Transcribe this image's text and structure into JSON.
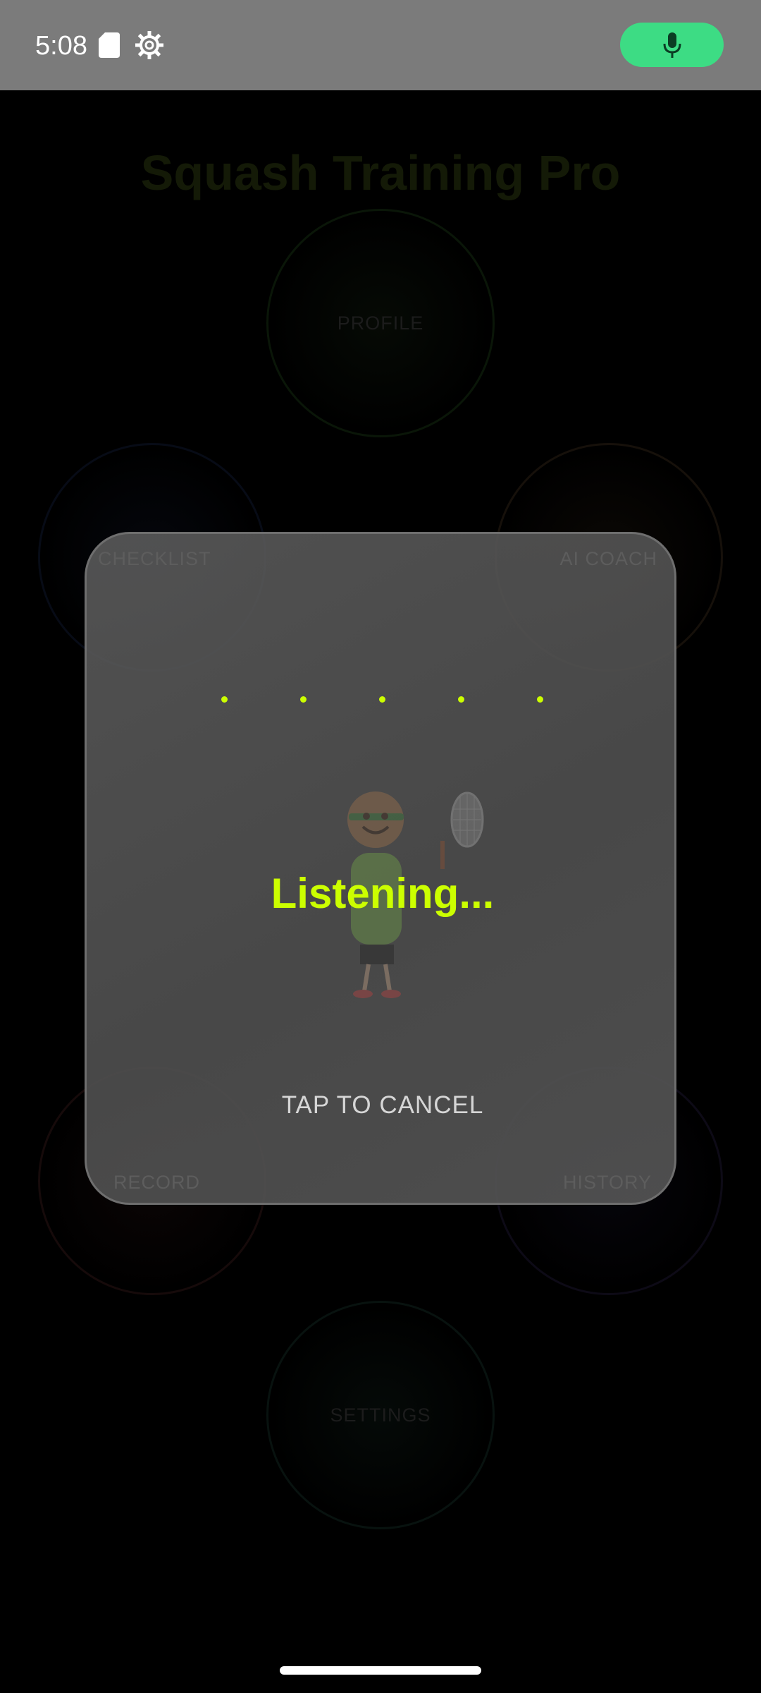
{
  "status_bar": {
    "time": "5:08",
    "icons": [
      "sd-card-icon",
      "gear-icon",
      "microphone-icon"
    ],
    "mic_pill_color": "#3ddc84"
  },
  "app": {
    "title": "Squash Training Pro",
    "menu": {
      "profile": "PROFILE",
      "checklist": "CHECKLIST",
      "ai_coach": "AI COACH",
      "record": "RECORD",
      "history": "HISTORY",
      "settings": "SETTINGS"
    }
  },
  "dialog": {
    "status": "Listening...",
    "cancel_label": "TAP TO CANCEL",
    "accent_color": "#ccff00",
    "mascot_icon": "squash-player-mascot-icon"
  }
}
